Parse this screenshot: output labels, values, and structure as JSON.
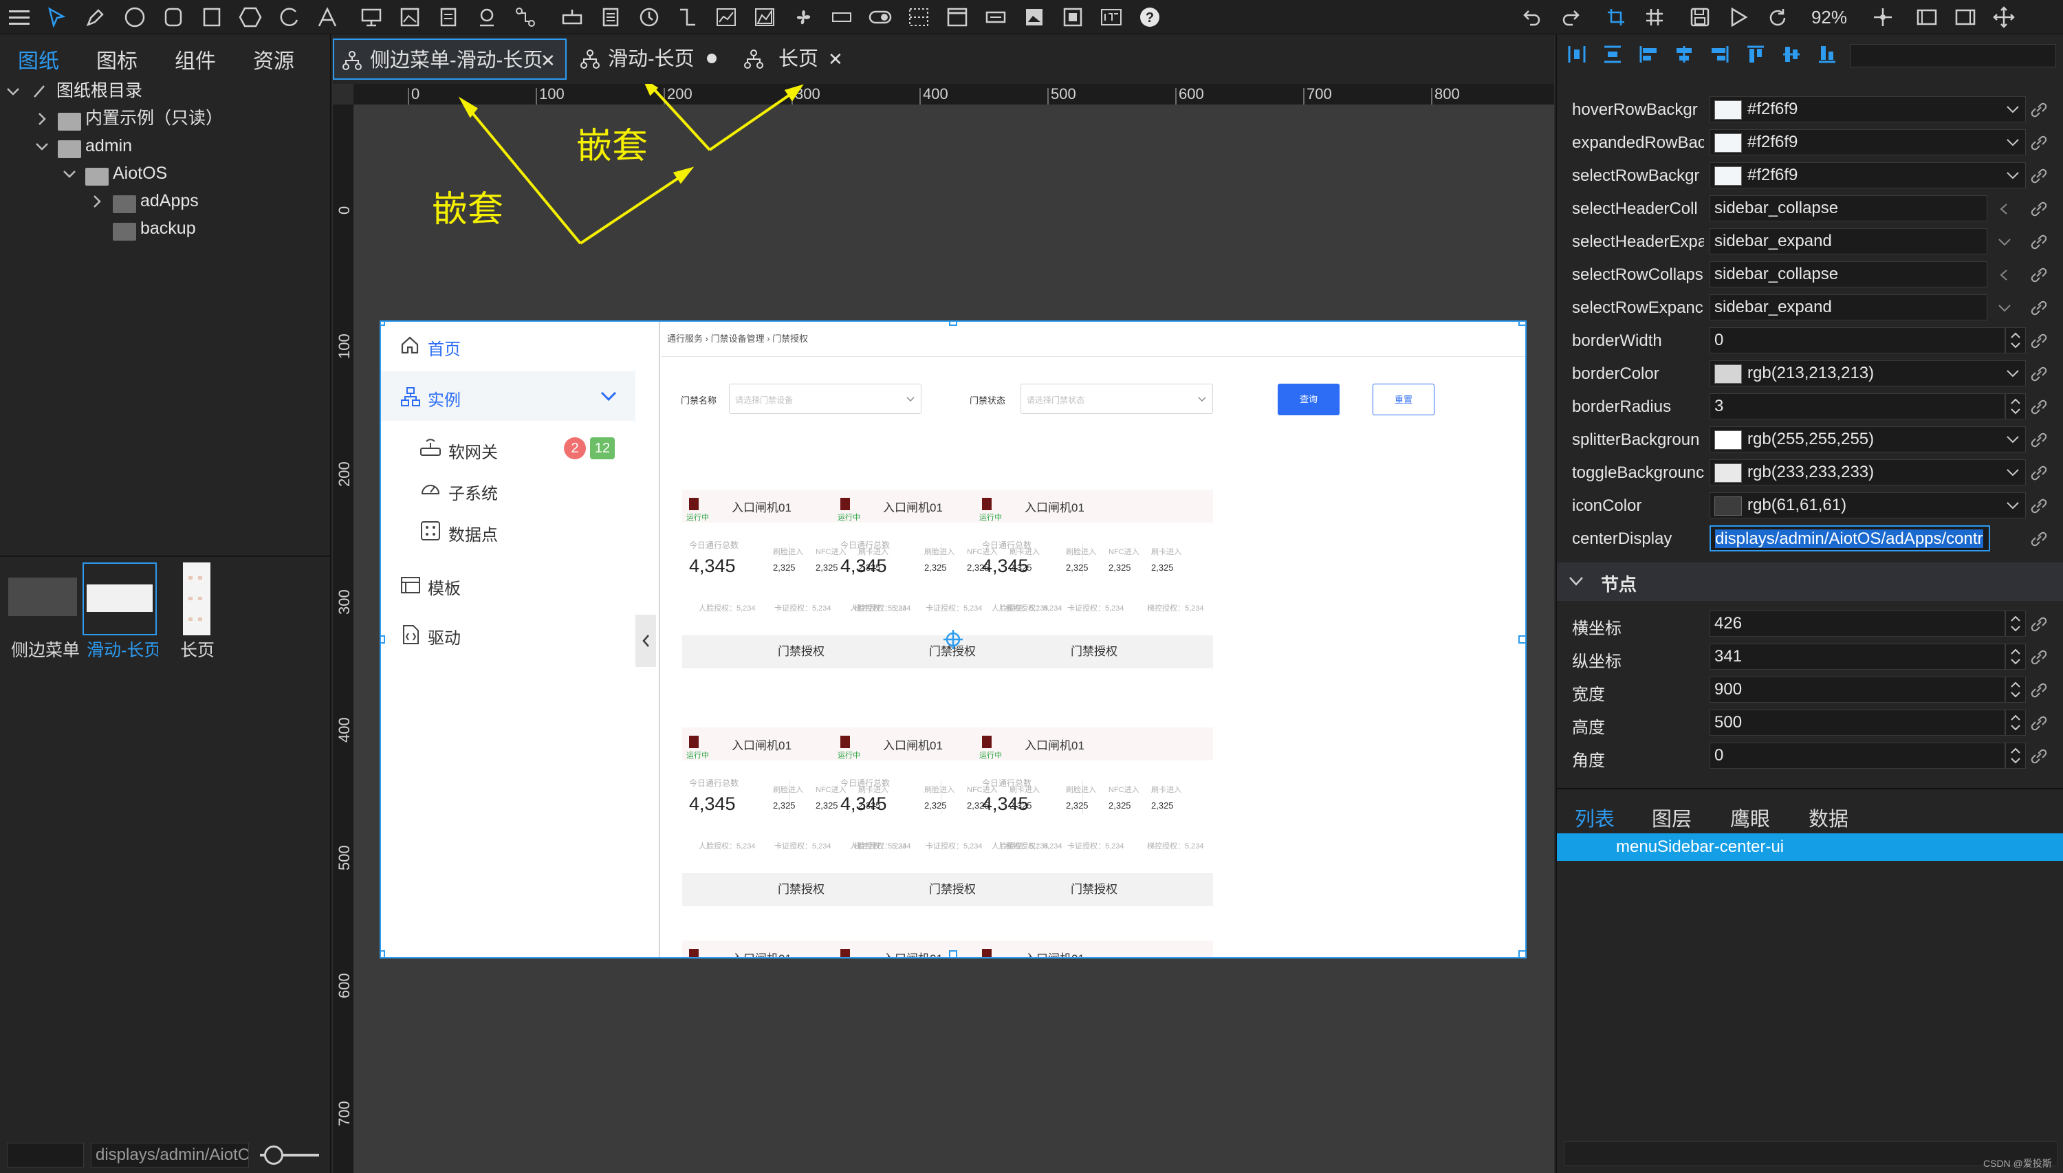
{
  "toolbar": {
    "zoom": "92%",
    "icons": [
      "menu-icon",
      "pointer-icon",
      "pen-icon",
      "circle-icon",
      "rounded-rect-icon",
      "rect-icon",
      "hexagon-icon",
      "arc-icon",
      "text-icon",
      "display-icon",
      "image-icon",
      "document-icon",
      "network-icon",
      "connector-icon",
      "component-icon",
      "list-icon",
      "clock-icon",
      "step-icon",
      "chart-line-icon",
      "chart-area-icon",
      "fan-icon",
      "input-icon",
      "toggle-icon",
      "grid-select-icon",
      "window-icon",
      "tab-icon",
      "image-frame-icon",
      "snapshot-icon",
      "logo-icon",
      "help-icon"
    ],
    "right_icons": [
      "undo-icon",
      "redo-icon",
      "selection-icon",
      "grid-icon",
      "save-icon",
      "play-icon",
      "refresh-icon",
      "crosshair-icon",
      "fit-width-icon",
      "fit-page-icon",
      "move-icon"
    ]
  },
  "left_panel": {
    "tabs": [
      "图纸",
      "图标",
      "组件",
      "资源"
    ],
    "tree": [
      {
        "label": "图纸根目录"
      },
      {
        "label": "内置示例（只读）"
      },
      {
        "label": "admin"
      },
      {
        "label": "AiotOS"
      },
      {
        "label": "adApps"
      },
      {
        "label": "backup"
      }
    ],
    "thumbnails": [
      "侧边菜单",
      "滑动-长页",
      "长页"
    ],
    "bottom_input": "displays/admin/AiotC"
  },
  "doc_tabs": [
    "侧边菜单-滑动-长页",
    "滑动-长页",
    "长页"
  ],
  "annotations": [
    "嵌套",
    "嵌套"
  ],
  "ruler": {
    "h_labels": [
      "0",
      "100",
      "200",
      "300",
      "400",
      "500",
      "600",
      "700",
      "800"
    ],
    "v_labels": [
      "0",
      "100",
      "200",
      "300",
      "400",
      "500",
      "600",
      "700"
    ]
  },
  "component": {
    "sidebar": {
      "home": "首页",
      "instance": "实例",
      "gateway": "软网关",
      "badge_red": "2",
      "badge_green": "12",
      "subsystem": "子系统",
      "datapoint": "数据点",
      "template": "模板",
      "driver": "驱动"
    },
    "breadcrumb": [
      "通行服务",
      "门禁设备管理",
      "门禁授权"
    ],
    "filter": {
      "name_label": "门禁名称",
      "name_placeholder": "请选择门禁设备",
      "status_label": "门禁状态",
      "status_placeholder": "请选择门禁状态",
      "query_btn": "查询",
      "reset_btn": "重置"
    },
    "card": {
      "title": "入口闸机01",
      "status": "运行中",
      "today_label": "今日通行总数",
      "today_value": "4,345",
      "stat_labels": [
        "刷脸进入",
        "NFC进入",
        "刷卡进入"
      ],
      "stat_values": [
        "2,325",
        "2,325",
        "2,325"
      ],
      "auth_text": [
        "人脸授权：5,234",
        "卡证授权：5,234",
        "梯控授权：5,234"
      ],
      "button": "门禁授权"
    }
  },
  "right_panel": {
    "props": [
      {
        "label": "hoverRowBackgr",
        "value": "#f2f6f9",
        "color": "#f2f6f9",
        "type": "color"
      },
      {
        "label": "expandedRowBac",
        "value": "#f2f6f9",
        "color": "#f2f6f9",
        "type": "color"
      },
      {
        "label": "selectRowBackgr",
        "value": "#f2f6f9",
        "color": "#f2f6f9",
        "type": "color"
      },
      {
        "label": "selectHeaderColl",
        "value": "sidebar_collapse",
        "type": "text"
      },
      {
        "label": "selectHeaderExpa",
        "value": "sidebar_expand",
        "type": "text"
      },
      {
        "label": "selectRowCollaps",
        "value": "sidebar_collapse",
        "type": "text"
      },
      {
        "label": "selectRowExpanc",
        "value": "sidebar_expand",
        "type": "text"
      },
      {
        "label": "borderWidth",
        "value": "0",
        "type": "number"
      },
      {
        "label": "borderColor",
        "value": "rgb(213,213,213)",
        "color": "rgb(213,213,213)",
        "type": "color"
      },
      {
        "label": "borderRadius",
        "value": "3",
        "type": "number"
      },
      {
        "label": "splitterBackgroun",
        "value": "rgb(255,255,255)",
        "color": "rgb(255,255,255)",
        "type": "color"
      },
      {
        "label": "toggleBackgrounc",
        "value": "rgb(233,233,233)",
        "color": "rgb(233,233,233)",
        "type": "color"
      },
      {
        "label": "iconColor",
        "value": "rgb(61,61,61)",
        "color": "rgb(61,61,61)",
        "type": "color"
      },
      {
        "label": "centerDisplay",
        "value": "displays/admin/AiotOS/adApps/contr",
        "type": "active"
      }
    ],
    "node_section": "节点",
    "node_props": [
      {
        "label": "横坐标",
        "value": "426"
      },
      {
        "label": "纵坐标",
        "value": "341"
      },
      {
        "label": "宽度",
        "value": "900"
      },
      {
        "label": "高度",
        "value": "500"
      },
      {
        "label": "角度",
        "value": "0"
      }
    ],
    "bottom_tabs": [
      "列表",
      "图层",
      "鹰眼",
      "数据"
    ],
    "list_item": "menuSidebar-center-ui",
    "watermark": "CSDN @爱投斯"
  }
}
